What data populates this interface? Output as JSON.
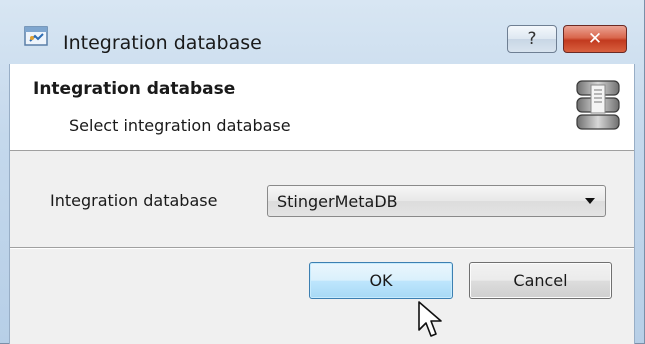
{
  "window": {
    "title": "Integration database",
    "help_label": "?",
    "close_label": "✕"
  },
  "header": {
    "title": "Integration database",
    "subtitle": "Select integration database"
  },
  "form": {
    "label": "Integration database",
    "selected_value": "StingerMetaDB"
  },
  "buttons": {
    "ok": "OK",
    "cancel": "Cancel"
  },
  "icons": {
    "app": "app-icon",
    "database": "database-icon",
    "dropdown": "chevron-down-icon",
    "cursor": "mouse-cursor-icon"
  },
  "colors": {
    "titlebar": "#c4d8ec",
    "close_button": "#c23a1f",
    "ok_button": "#bee6fd",
    "client_background": "#f0f0f0"
  }
}
